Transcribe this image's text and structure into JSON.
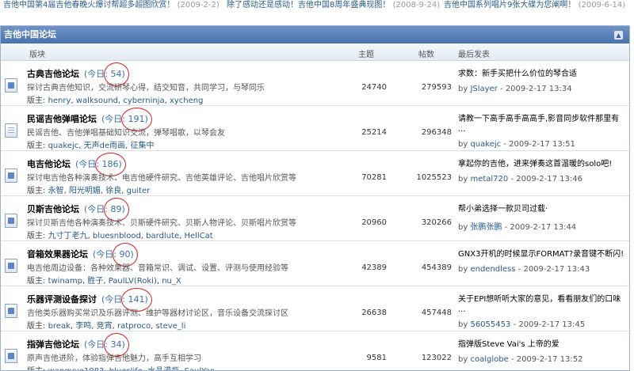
{
  "topbar": {
    "items": [
      {
        "text": "吉他中国第4届吉他春晚火爆讨帮超多超图欣赏！",
        "date": "(2009-2-2)"
      },
      {
        "text": "除了感动还是感动！吉他中国8周年盛典现图！",
        "date": "(2008-9-24)"
      },
      {
        "text": "吉他中国系列唱片9张大碟为您阐啊！",
        "date": "(2009-6-14)"
      }
    ]
  },
  "panel": {
    "title": "吉他中国论坛",
    "collapse_icon": "chevron-up-icon"
  },
  "columns": {
    "board": "版块",
    "topics": "主题",
    "posts": "帖数",
    "last_post": "最后发表"
  },
  "labels": {
    "today_prefix": "(今日: ",
    "today_suffix": ")",
    "moderators": "版主: ",
    "by": "by ",
    "sep": " - "
  },
  "forums": [
    {
      "name": "古典吉他论坛",
      "today": "54",
      "desc": "探讨古典吉他知识，交流研琴心得，结交知音，共同学习，与琴同乐",
      "moderators": [
        "henry",
        "walksound",
        "cyberninja",
        "xycheng"
      ],
      "topics": "24740",
      "posts": "279593",
      "last_title": "求数：新手买把什么价位的琴合适",
      "last_user": "JSlayer",
      "last_time": "2009-2-17 13:34",
      "icon": "new"
    },
    {
      "name": "民谣吉他弹唱论坛",
      "today": "191",
      "desc": "民谣吉他、吉他弹唱基础知识交流，弹琴唱歌，以琴会友",
      "moderators": [
        "quakejc",
        "无声de雨画",
        "征集中"
      ],
      "topics": "25214",
      "posts": "296348",
      "last_title": "请教一下高手高手高高手,影音同步软件那里有 ...",
      "last_user": "quakejc",
      "last_time": "2009-2-17 13:51",
      "icon": "plain"
    },
    {
      "name": "电吉他论坛",
      "today": "186",
      "desc": "探讨电吉他各种演奏技术、电吉他硬件研究、吉他英雄评论、吉他唱片欣赏等",
      "moderators": [
        "永智",
        "阳光明媚",
        "徐良",
        "guiter"
      ],
      "topics": "70281",
      "posts": "1025523",
      "last_title": "拿起你的吉他，进来弹奏这首温暖的solo吧!",
      "last_user": "metal720",
      "last_time": "2009-2-17 13:46",
      "icon": "new"
    },
    {
      "name": "贝斯吉他论坛",
      "today": "89",
      "desc": "探讨贝斯吉他各种演奏技术、贝斯硬件研究、贝斯人物评论、贝斯唱片欣赏等",
      "moderators": [
        "九寸丁老九",
        "bluesnblood",
        "bardlute",
        "HellCat"
      ],
      "topics": "20960",
      "posts": "320266",
      "last_title": "帮小弟选择一款贝司过载·",
      "last_user": "张鹏张鹏",
      "last_time": "2009-2-17 13:44",
      "icon": "new"
    },
    {
      "name": "音箱效果器论坛",
      "today": "90",
      "desc": "电吉他周边设备：各种效果器、音箱常识、调试、设置、评测与使用经验等",
      "moderators": [
        "twinamp",
        "胜子",
        "PaulLV(Roki)",
        "nu_X"
      ],
      "topics": "42389",
      "posts": "454389",
      "last_title": "GNX3开机的时候显示FORMAT?录音键不断闪!",
      "last_user": "endendless",
      "last_time": "2009-2-17 13:43",
      "icon": "new"
    },
    {
      "name": "乐器评测设备探讨",
      "today": "141",
      "desc": "吉他类乐器购买常识及乐器评测、维护等器材讨论区，音乐设备交流探讨区",
      "moderators": [
        "break",
        "李鸣",
        "竞宵",
        "ratproco",
        "steve_li"
      ],
      "topics": "26638",
      "posts": "457448",
      "last_title": "关于EPI想听听大家的意见，看看朋友们的口味 ...",
      "last_user": "56055453",
      "last_time": "2009-2-17 13:45",
      "icon": "new"
    },
    {
      "name": "指弹吉他论坛",
      "today": "34",
      "desc": "原声吉他进阶，体验指弹吉他魅力，高手互相学习",
      "moderators": [
        "wangyue1983",
        "blueslife",
        "水晶灌瓶",
        "SaulYan"
      ],
      "topics": "9581",
      "posts": "123022",
      "last_title": "指弹版Steve Vai's 上帝的爱",
      "last_user": "coalglobe",
      "last_time": "2009-2-17 13:52",
      "icon": "new"
    }
  ]
}
